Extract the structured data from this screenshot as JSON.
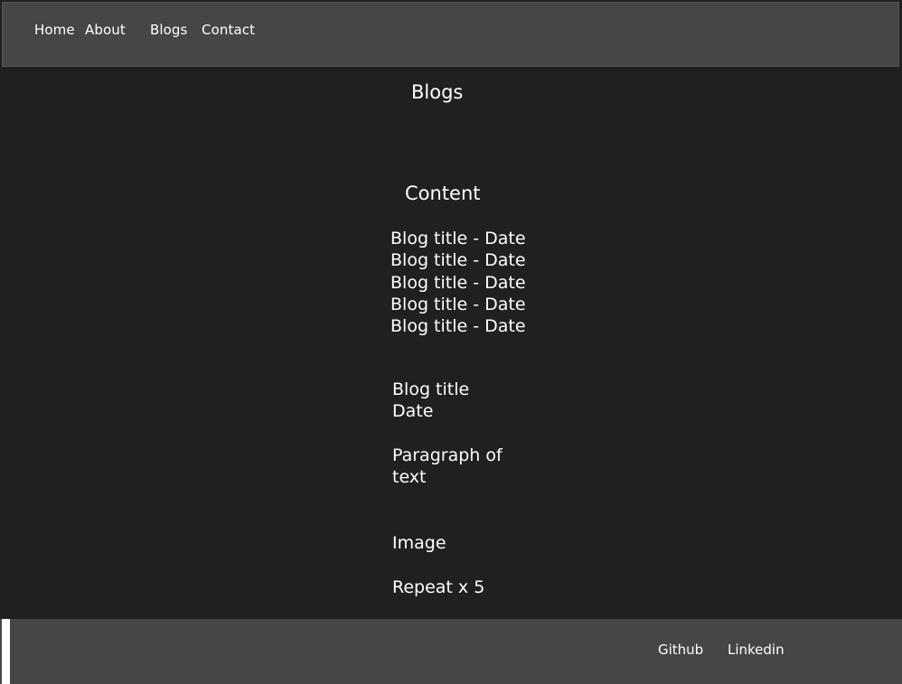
{
  "nav": {
    "items": [
      {
        "label": "Home"
      },
      {
        "label": "About"
      },
      {
        "label": "Blogs"
      },
      {
        "label": "Contact"
      }
    ]
  },
  "page": {
    "title": "Blogs",
    "content_heading": "Content"
  },
  "blog_list": [
    "Blog title - Date",
    "Blog title - Date",
    "Blog title - Date",
    "Blog title - Date",
    "Blog title - Date"
  ],
  "blog_post": {
    "title": "Blog title",
    "date": "Date",
    "paragraph_line1": "Paragraph of",
    "paragraph_line2": "text",
    "image": "Image",
    "repeat_note": "Repeat x 5"
  },
  "footer": {
    "links": [
      {
        "label": "Github"
      },
      {
        "label": "Linkedin"
      }
    ]
  },
  "colors": {
    "background": "#202020",
    "bar": "#474645",
    "text": "#ffffff"
  }
}
